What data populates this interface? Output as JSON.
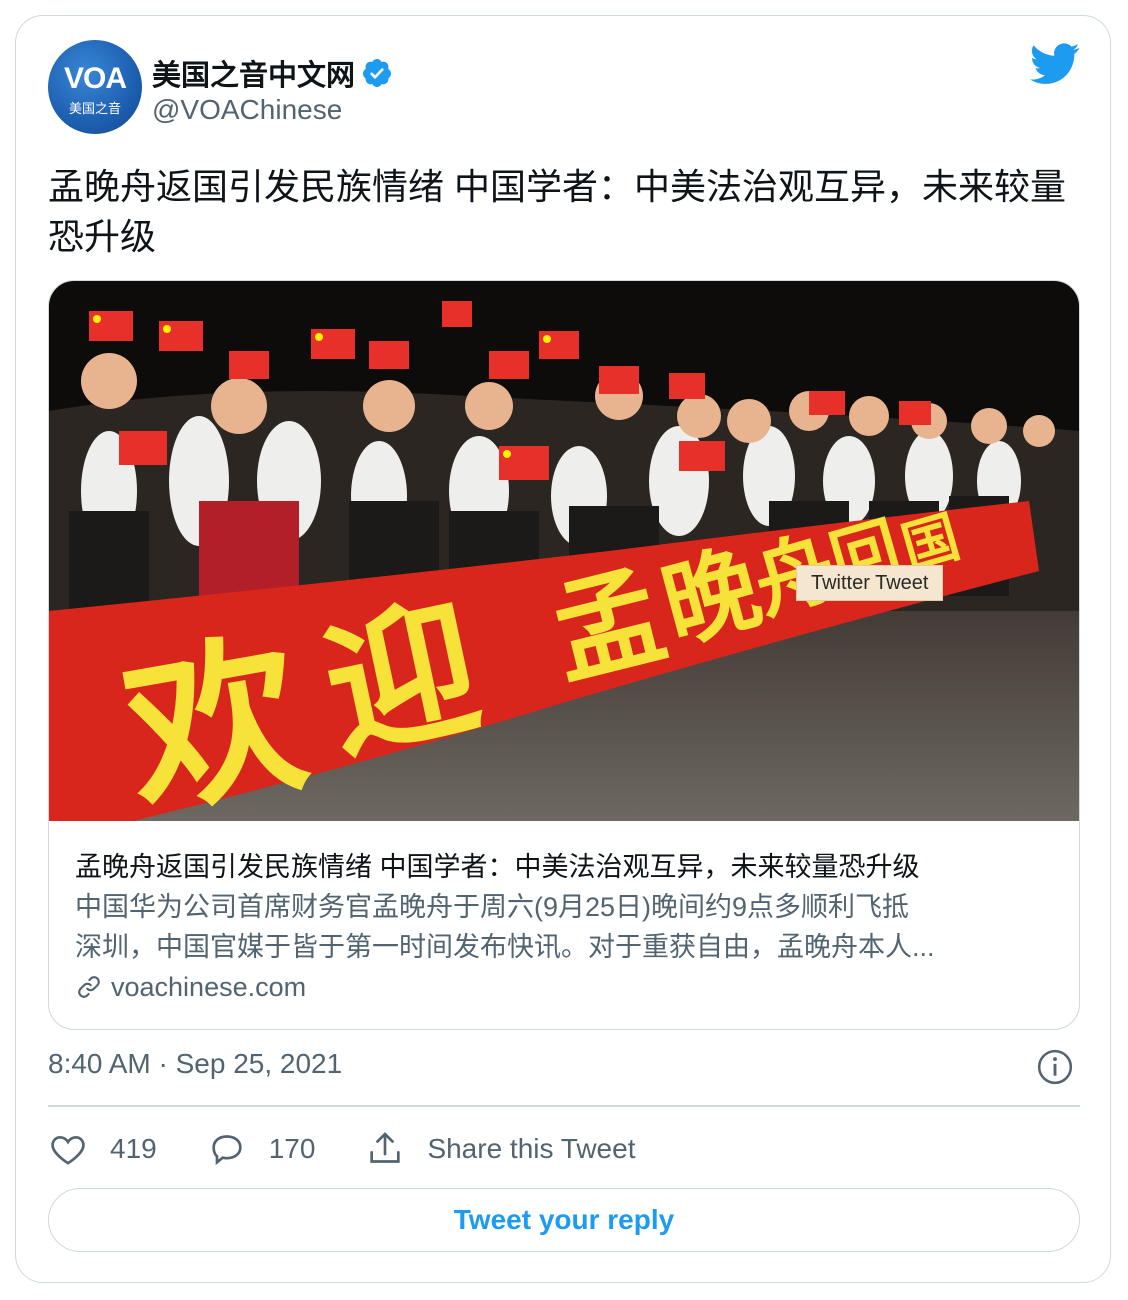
{
  "author": {
    "display_name": "美国之音中文网",
    "handle": "@VOAChinese",
    "avatar_logo": "VOA",
    "avatar_subtitle": "美国之音",
    "verified": true
  },
  "tweet": {
    "text": "孟晚舟返国引发民族情绪 中国学者：中美法治观互异，未来较量恐升级",
    "timestamp": "8:40 AM · Sep 25, 2021"
  },
  "link_card": {
    "image_banner_text": "欢 迎 孟晚舟 回 国",
    "image_tooltip": "Twitter Tweet",
    "title": "孟晚舟返国引发民族情绪 中国学者：中美法治观互异，未来较量恐升级",
    "description_line1": "中国华为公司首席财务官孟晚舟于周六(9月25日)晚间约9点多顺利飞抵",
    "description_line2": "深圳，中国官媒于皆于第一时间发布快讯。对于重获自由，孟晚舟本人...",
    "domain": "voachinese.com"
  },
  "actions": {
    "like_count": "419",
    "reply_count": "170",
    "share_label": "Share this Tweet",
    "reply_button": "Tweet your reply"
  },
  "colors": {
    "accent": "#1d9bf0",
    "text_primary": "#0f1419",
    "text_secondary": "#536471",
    "border": "#cfd9de",
    "banner_red": "#d9261c",
    "banner_yellow": "#f7e23a"
  },
  "icons": [
    "verified-badge-icon",
    "twitter-bird-icon",
    "link-icon",
    "info-icon",
    "heart-icon",
    "reply-icon",
    "share-icon"
  ]
}
